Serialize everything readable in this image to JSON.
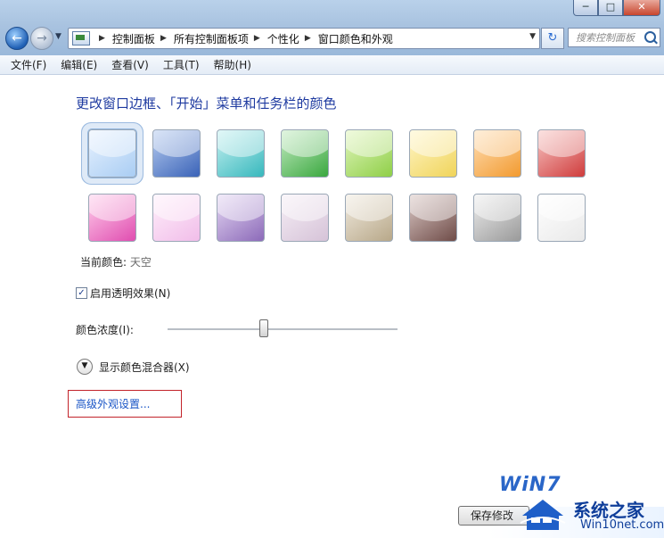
{
  "window": {
    "min_label": "─",
    "max_label": "□",
    "close_label": "✕"
  },
  "nav": {
    "back_glyph": "←",
    "forward_glyph": "→",
    "dropdown_glyph": "▼"
  },
  "address": {
    "crumbs": [
      "控制面板",
      "所有控制面板项",
      "个性化",
      "窗口颜色和外观"
    ],
    "separator": "▶",
    "dropdown_glyph": "▼",
    "refresh_glyph": "↻"
  },
  "search": {
    "placeholder": "搜索控制面板"
  },
  "menu": [
    "文件(F)",
    "编辑(E)",
    "查看(V)",
    "工具(T)",
    "帮助(H)"
  ],
  "heading": "更改窗口边框、「开始」菜单和任务栏的颜色",
  "swatches": [
    {
      "name": "sky",
      "c1": "#e8f2ff",
      "c2": "#a9cdf3",
      "selected": true
    },
    {
      "name": "twilight",
      "c1": "#b8cdf0",
      "c2": "#3a63b8"
    },
    {
      "name": "sea",
      "c1": "#c7f1f1",
      "c2": "#37b8bd"
    },
    {
      "name": "leaf",
      "c1": "#c6ecc4",
      "c2": "#3aa83f"
    },
    {
      "name": "lime",
      "c1": "#e2f6bf",
      "c2": "#8fcf47"
    },
    {
      "name": "lemon",
      "c1": "#fff6c9",
      "c2": "#f0d45a"
    },
    {
      "name": "tangerine",
      "c1": "#ffe0b8",
      "c2": "#f29a2f"
    },
    {
      "name": "ruby",
      "c1": "#f8c7c5",
      "c2": "#cf3c3c"
    },
    {
      "name": "fuchsia",
      "c1": "#ffd0ec",
      "c2": "#e04db0"
    },
    {
      "name": "blush",
      "c1": "#fff0fb",
      "c2": "#f1bde9"
    },
    {
      "name": "violet",
      "c1": "#e5d8f3",
      "c2": "#8c6ab9"
    },
    {
      "name": "lavender",
      "c1": "#f6eff6",
      "c2": "#d6c3d8"
    },
    {
      "name": "taupe",
      "c1": "#f1ebe0",
      "c2": "#b8a889"
    },
    {
      "name": "chocolate",
      "c1": "#dbc9c6",
      "c2": "#6f4c48"
    },
    {
      "name": "slate",
      "c1": "#eeeeee",
      "c2": "#9a9a9a"
    },
    {
      "name": "frost",
      "c1": "#ffffff",
      "c2": "#e9e9e9"
    }
  ],
  "current_color": {
    "label": "当前颜色:",
    "value": "天空"
  },
  "transparency": {
    "label": "启用透明效果(N)",
    "checked": true,
    "check_glyph": "✓"
  },
  "intensity": {
    "label": "颜色浓度(I):",
    "value_fraction": 0.42
  },
  "mixer": {
    "label": "显示颜色混合器(X)",
    "glyph": "▼"
  },
  "advanced_link": "高级外观设置...",
  "save_button": "保存修改",
  "watermark": {
    "brand": "WiN7",
    "name": "系统之家",
    "url": "Win10net.com"
  }
}
